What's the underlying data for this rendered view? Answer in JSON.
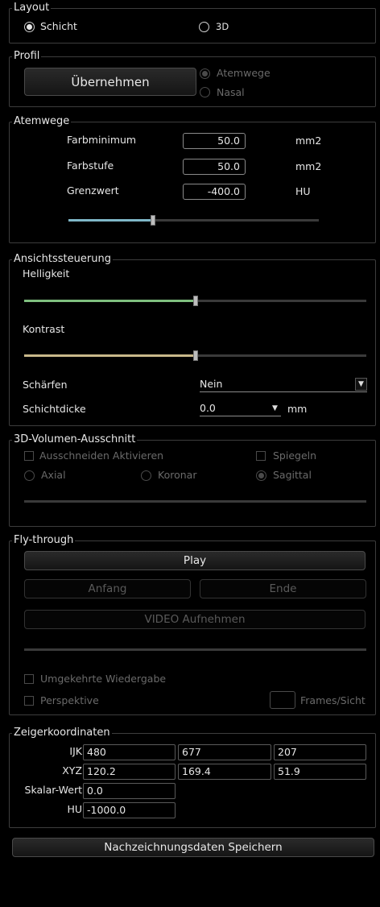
{
  "layout": {
    "legend": "Layout",
    "options": [
      {
        "label": "Schicht",
        "selected": true
      },
      {
        "label": "3D",
        "selected": false
      }
    ]
  },
  "profil": {
    "legend": "Profil",
    "apply_button": "Übernehmen",
    "options": [
      {
        "label": "Atemwege",
        "selected": true,
        "enabled": false
      },
      {
        "label": "Nasal",
        "selected": false,
        "enabled": false
      }
    ]
  },
  "atemwege": {
    "legend": "Atemwege",
    "rows": [
      {
        "label": "Farbminimum",
        "value": "50.0",
        "unit": "mm2"
      },
      {
        "label": "Farbstufe",
        "value": "50.0",
        "unit": "mm2"
      },
      {
        "label": "Grenzwert",
        "value": "-400.0",
        "unit": "HU"
      }
    ],
    "slider_fraction": 0.34
  },
  "ansicht": {
    "legend": "Ansichtssteuerung",
    "helligkeit_label": "Helligkeit",
    "helligkeit_fraction": 0.5,
    "kontrast_label": "Kontrast",
    "kontrast_fraction": 0.5,
    "schaerfen_label": "Schärfen",
    "schaerfen_value": "Nein",
    "schichtdicke_label": "Schichtdicke",
    "schichtdicke_value": "0.0",
    "schichtdicke_unit": "mm",
    "colors": {
      "helligkeit": "#7fbf7f",
      "kontrast": "#c8b88a"
    }
  },
  "volumen": {
    "legend": "3D-Volumen-Ausschnitt",
    "ausschneiden_label": "Ausschneiden Aktivieren",
    "spiegeln_label": "Spiegeln",
    "planes": [
      {
        "label": "Axial",
        "selected": false
      },
      {
        "label": "Koronar",
        "selected": false
      },
      {
        "label": "Sagittal",
        "selected": true
      }
    ]
  },
  "fly": {
    "legend": "Fly-through",
    "play_button": "Play",
    "anfang_button": "Anfang",
    "ende_button": "Ende",
    "video_button": "VIDEO Aufnehmen",
    "umgekehrt_label": "Umgekehrte Wiedergabe",
    "perspektive_label": "Perspektive",
    "frames_label": "Frames/Sicht"
  },
  "zeiger": {
    "legend": "Zeigerkoordinaten",
    "ijk_label": "IJK",
    "ijk": [
      "480",
      "677",
      "207"
    ],
    "xyz_label": "XYZ",
    "xyz": [
      "120.2",
      "169.4",
      "51.9"
    ],
    "skalar_label": "Skalar-Wert",
    "skalar_value": "0.0",
    "hu_label": "HU",
    "hu_value": "-1000.0"
  },
  "save_button": "Nachzeichnungsdaten Speichern",
  "accent_slider_color": "#7fb7c8"
}
